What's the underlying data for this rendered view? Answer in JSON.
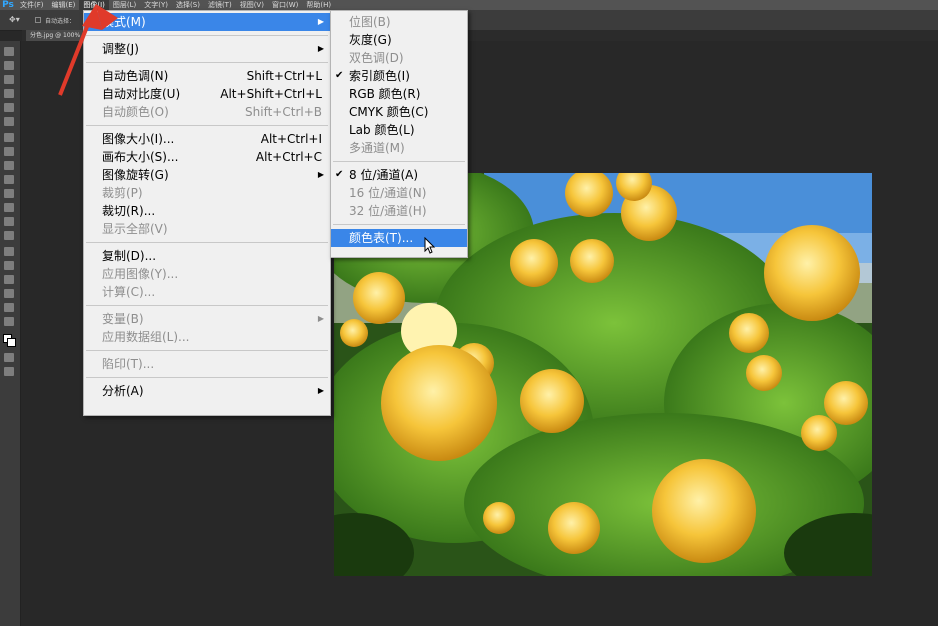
{
  "menubar": {
    "logo": "Ps",
    "items": [
      "文件(F)",
      "编辑(E)",
      "图像(I)",
      "图层(L)",
      "文字(Y)",
      "选择(S)",
      "滤镜(T)",
      "视图(V)",
      "窗口(W)",
      "帮助(H)"
    ],
    "active_index": 2
  },
  "options_bar": {
    "auto_select": "自动选择："
  },
  "document_tab": {
    "title": "分色.jpg @ 100%"
  },
  "image_menu": {
    "items": [
      {
        "label": "模式(M)",
        "shortcut": "",
        "submenu": true,
        "disabled": false,
        "highlighted": true
      },
      {
        "sep": true
      },
      {
        "label": "调整(J)",
        "shortcut": "",
        "submenu": true,
        "disabled": false
      },
      {
        "sep": true
      },
      {
        "label": "自动色调(N)",
        "shortcut": "Shift+Ctrl+L",
        "disabled": false
      },
      {
        "label": "自动对比度(U)",
        "shortcut": "Alt+Shift+Ctrl+L",
        "disabled": false
      },
      {
        "label": "自动颜色(O)",
        "shortcut": "Shift+Ctrl+B",
        "disabled": true
      },
      {
        "sep": true
      },
      {
        "label": "图像大小(I)...",
        "shortcut": "Alt+Ctrl+I",
        "disabled": false
      },
      {
        "label": "画布大小(S)...",
        "shortcut": "Alt+Ctrl+C",
        "disabled": false
      },
      {
        "label": "图像旋转(G)",
        "shortcut": "",
        "submenu": true,
        "disabled": false
      },
      {
        "label": "裁剪(P)",
        "shortcut": "",
        "disabled": true
      },
      {
        "label": "裁切(R)...",
        "shortcut": "",
        "disabled": false
      },
      {
        "label": "显示全部(V)",
        "shortcut": "",
        "disabled": true
      },
      {
        "sep": true
      },
      {
        "label": "复制(D)...",
        "shortcut": "",
        "disabled": false
      },
      {
        "label": "应用图像(Y)...",
        "shortcut": "",
        "disabled": true
      },
      {
        "label": "计算(C)...",
        "shortcut": "",
        "disabled": true
      },
      {
        "sep": true
      },
      {
        "label": "变量(B)",
        "shortcut": "",
        "submenu": true,
        "disabled": true
      },
      {
        "label": "应用数据组(L)...",
        "shortcut": "",
        "disabled": true
      },
      {
        "sep": true
      },
      {
        "label": "陷印(T)...",
        "shortcut": "",
        "disabled": true
      },
      {
        "sep": true
      },
      {
        "label": "分析(A)",
        "shortcut": "",
        "submenu": true,
        "disabled": false
      }
    ]
  },
  "mode_submenu": {
    "items": [
      {
        "label": "位图(B)",
        "disabled": true
      },
      {
        "label": "灰度(G)",
        "disabled": false
      },
      {
        "label": "双色调(D)",
        "disabled": true
      },
      {
        "label": "索引颜色(I)",
        "disabled": false,
        "checked": true
      },
      {
        "label": "RGB 颜色(R)",
        "disabled": false
      },
      {
        "label": "CMYK 颜色(C)",
        "disabled": false
      },
      {
        "label": "Lab 颜色(L)",
        "disabled": false
      },
      {
        "label": "多通道(M)",
        "disabled": true
      },
      {
        "sep": true
      },
      {
        "label": "8 位/通道(A)",
        "disabled": false,
        "checked": true
      },
      {
        "label": "16 位/通道(N)",
        "disabled": true
      },
      {
        "label": "32 位/通道(H)",
        "disabled": true
      },
      {
        "sep": true
      },
      {
        "label": "颜色表(T)...",
        "disabled": false,
        "highlighted": true
      }
    ]
  },
  "icons": {
    "check": "✔",
    "submenu_arrow": "▶"
  },
  "colors": {
    "highlight": "#3a86e8",
    "annotation_arrow": "#e03a2a"
  }
}
